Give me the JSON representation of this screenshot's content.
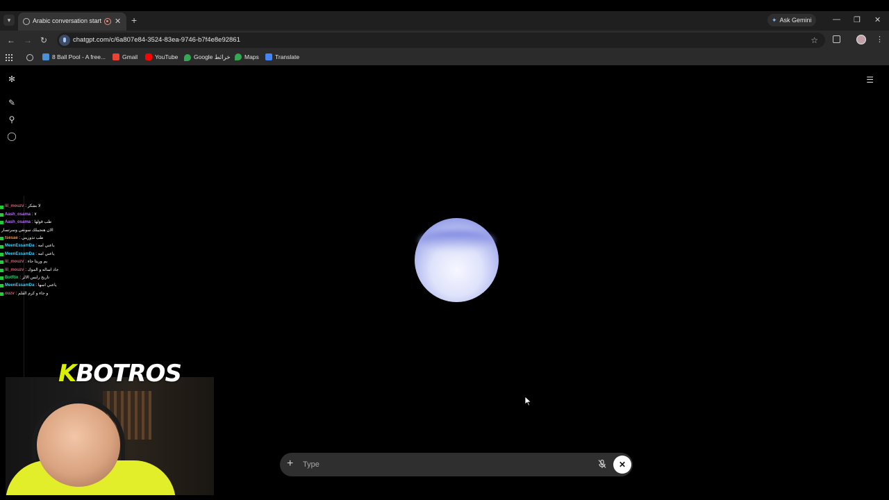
{
  "browser": {
    "tab": {
      "title": "Arabic conversation start"
    },
    "ask_gemini": "Ask Gemini",
    "url": "chatgpt.com/c/6a807e84-3524-83ea-9746-b7f4e8e92861",
    "bookmarks": [
      {
        "label": "8 Ball Pool - A free...",
        "icon": "8ball-icon",
        "color": "#4a90d9"
      },
      {
        "label": "Gmail",
        "icon": "gmail-icon",
        "color": "#ea4335"
      },
      {
        "label": "YouTube",
        "icon": "youtube-icon",
        "color": "#ff0000"
      },
      {
        "label": "Google خرائط",
        "icon": "maps-icon",
        "color": "#34a853"
      },
      {
        "label": "Maps",
        "icon": "maps-icon",
        "color": "#34a853"
      },
      {
        "label": "Translate",
        "icon": "translate-icon",
        "color": "#4285f4"
      }
    ]
  },
  "composer": {
    "placeholder": "Type"
  },
  "overlay": {
    "logo_k": "K",
    "logo_rest": "BOTROS",
    "chat": [
      {
        "user": "",
        "msg": "",
        "color": "#ff4d6d"
      },
      {
        "user": "lil_mouzv",
        "msg": ": لا بشكر",
        "color": "#ff4d6d"
      },
      {
        "user": "Aash_osama",
        "msg": ": ٧",
        "color": "#c06cff"
      },
      {
        "user": "Aash_osama",
        "msg": ": طب قولها",
        "color": "#c06cff"
      },
      {
        "user": "",
        "msg": "الان هنجيبلك سونغي وسرتسار",
        "color": "#ffffff"
      },
      {
        "user": "tsesae",
        "msg": ": طب تذوريني",
        "color": "#ff8c42"
      },
      {
        "user": "MeenEssamDa",
        "msg": ": ياعني امه",
        "color": "#3ad1ff"
      },
      {
        "user": "MeenEssamDa",
        "msg": ": ياعني امه",
        "color": "#3ad1ff"
      },
      {
        "user": "lil_mouzv",
        "msg": ": يم وريتا جاء",
        "color": "#ff4d6d"
      },
      {
        "user": "lil_mouzv",
        "msg": ": جاد اساله و الموك",
        "color": "#ff4d6d"
      },
      {
        "user": "BotRix",
        "msg": ": تاريخ رايس الالز",
        "color": "#2ecc71"
      },
      {
        "user": "MeenEssamDa",
        "msg": ": ياعني اسها",
        "color": "#3ad1ff"
      },
      {
        "user": "ouzv",
        "msg": ": و جاء و كرم القلم",
        "color": "#ff4d6d"
      }
    ]
  }
}
